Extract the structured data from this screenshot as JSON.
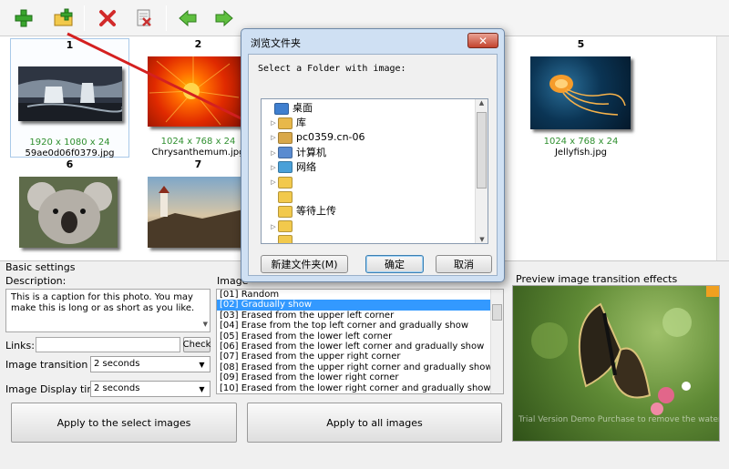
{
  "gallery": {
    "thumbs": [
      {
        "num": "1",
        "dims": "1920 x 1080 x 24",
        "name": "59ae0d06f0379.jpg"
      },
      {
        "num": "2",
        "dims": "1024 x 768 x 24",
        "name": "Chrysanthemum.jpg"
      },
      {
        "num": "5",
        "dims": "1024 x 768 x 24",
        "name": "Jellyfish.jpg"
      },
      {
        "num": "6",
        "dims": "",
        "name": ""
      },
      {
        "num": "7",
        "dims": "",
        "name": ""
      }
    ]
  },
  "basic": {
    "title": "Basic settings",
    "description_label": "Description:",
    "description_value": "This is a caption for this photo. You may make this is long or as short as you like.",
    "links_label": "Links:",
    "links_value": "",
    "check_label": "Check",
    "transition_label": "Image transition time:",
    "transition_value": "2 seconds",
    "display_label": "Image Display time:",
    "display_value": "2 seconds",
    "apply_select": "Apply to the select images",
    "apply_all": "Apply to all images"
  },
  "effects": {
    "label": "Image",
    "items": [
      "[01] Random",
      "[02] Gradually show",
      "[03] Erased from the upper left corner",
      "[04] Erase from the top left corner and gradually show",
      "[05] Erased from the lower left corner",
      "[06] Erased from the lower left corner and gradually show",
      "[07] Erased from the upper right corner",
      "[08] Erased from the upper right corner and gradually show",
      "[09] Erased from the lower right corner",
      "[10] Erased from the lower right corner and gradually show"
    ],
    "selected_index": 1
  },
  "preview": {
    "title": "Preview image transition effects",
    "watermark": "Trial Version Demo Purchase to remove the watermark"
  },
  "dialog": {
    "title": "浏览文件夹",
    "close_symbol": "✕",
    "prompt": "Select a Folder with image:",
    "tree": [
      {
        "label": "桌面",
        "indent": 0,
        "expander": "",
        "icon": "desktop-icon"
      },
      {
        "label": "库",
        "indent": 1,
        "expander": "▷",
        "icon": "library-icon"
      },
      {
        "label": "pc0359.cn-06",
        "indent": 1,
        "expander": "▷",
        "icon": "user-folder-icon"
      },
      {
        "label": "计算机",
        "indent": 1,
        "expander": "▷",
        "icon": "computer-icon"
      },
      {
        "label": "网络",
        "indent": 1,
        "expander": "▷",
        "icon": "network-icon"
      },
      {
        "label": "",
        "indent": 1,
        "expander": "▷",
        "icon": "folder-icon"
      },
      {
        "label": "",
        "indent": 1,
        "expander": "",
        "icon": "folder-icon"
      },
      {
        "label": "等待上传",
        "indent": 1,
        "expander": "",
        "icon": "folder-icon"
      },
      {
        "label": "",
        "indent": 1,
        "expander": "▷",
        "icon": "folder-icon"
      },
      {
        "label": "",
        "indent": 1,
        "expander": "",
        "icon": "folder-icon"
      }
    ],
    "new_folder": "新建文件夹(M)",
    "ok": "确定",
    "cancel": "取消"
  },
  "colors": {
    "accent_green": "#2f8f2f",
    "selection_blue": "#3399ff",
    "arrow_red": "#d42020"
  }
}
